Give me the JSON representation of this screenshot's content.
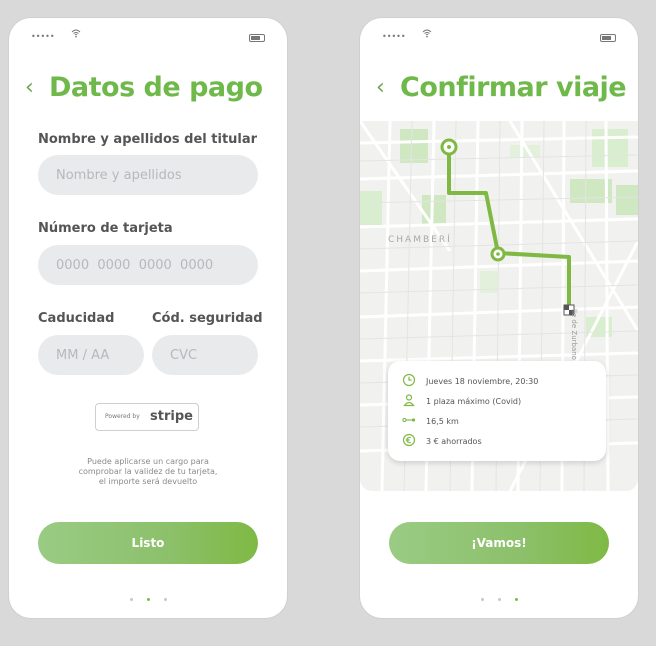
{
  "left_screen": {
    "status_signal": "•••••",
    "title": "Datos de pago",
    "holder_label": "Nombre y apellidos del titular",
    "holder_placeholder": "Nombre y apellidos",
    "card_label": "Número de tarjeta",
    "card_placeholder": "0000  0000  0000  0000",
    "expiry_label": "Caducidad",
    "expiry_placeholder": "MM / AA",
    "cvc_label": "Cód. seguridad",
    "cvc_placeholder": "CVC",
    "stripe_prefix": "Powered by",
    "stripe_wordmark": "stripe",
    "note_lines": [
      "Puede aplicarse un cargo para",
      "comprobar la validez de tu tarjeta,",
      "el importe será devuelto"
    ],
    "button_label": "Listo",
    "pager_active": 1
  },
  "right_screen": {
    "status_signal": "•••••",
    "title": "Confirmar viaje",
    "map_label_district": "CHAMBERÍ",
    "map_label_street": "lle de Zurbano",
    "trip_datetime": "Jueves 18 noviembre, 20:30",
    "trip_seats": "1 plaza máximo (Covid)",
    "trip_distance": "16,5 km",
    "trip_savings": "3 € ahorrados",
    "button_label": "¡Vamos!",
    "pager_active": 2
  },
  "colors": {
    "accent": "#6fb84a",
    "route": "#7fb944",
    "field_bg": "#e8eaec",
    "background": "#d9d9d9"
  },
  "icons": [
    "back-chevron-icon",
    "wifi-icon",
    "battery-icon",
    "clock-icon",
    "person-icon",
    "distance-icon",
    "euro-icon",
    "route-start-icon",
    "route-stop-icon",
    "destination-icon"
  ]
}
